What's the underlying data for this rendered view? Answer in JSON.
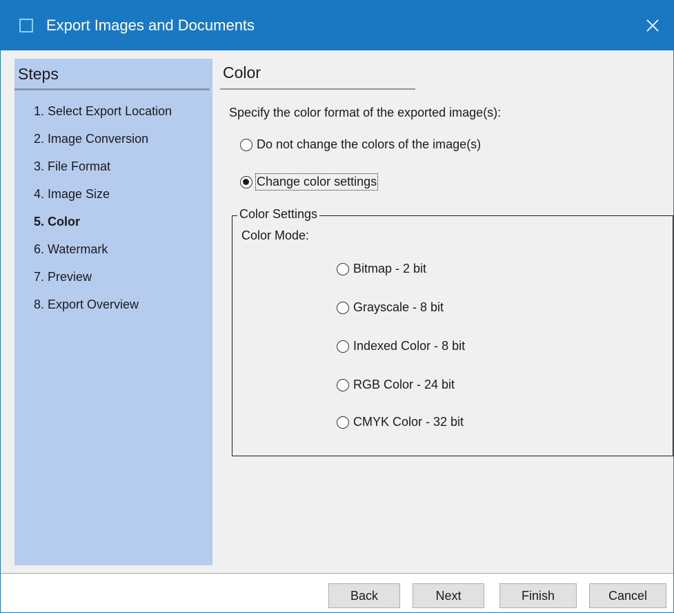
{
  "window": {
    "title": "Export Images and Documents",
    "icon": "app-window-icon",
    "close_icon": "close-icon",
    "accent_color": "#1a78c2",
    "sidebar_color": "#b6ccef"
  },
  "sidebar": {
    "title": "Steps",
    "items": [
      {
        "label": "1. Select Export Location",
        "active": false
      },
      {
        "label": "2. Image Conversion",
        "active": false
      },
      {
        "label": "3. File Format",
        "active": false
      },
      {
        "label": "4. Image Size",
        "active": false
      },
      {
        "label": "5. Color",
        "active": true
      },
      {
        "label": "6. Watermark",
        "active": false
      },
      {
        "label": "7. Preview",
        "active": false
      },
      {
        "label": "8. Export Overview",
        "active": false
      }
    ]
  },
  "main": {
    "title": "Color",
    "instruction": "Specify the color format of the exported image(s):",
    "options": [
      {
        "label": "Do not change the colors of the image(s)",
        "checked": false
      },
      {
        "label": "Change color settings",
        "checked": true
      }
    ],
    "color_settings": {
      "legend": "Color Settings",
      "mode_label": "Color Mode:",
      "modes": [
        {
          "label": "Bitmap - 2 bit",
          "checked": false
        },
        {
          "label": "Grayscale - 8 bit",
          "checked": false
        },
        {
          "label": "Indexed Color - 8 bit",
          "checked": false
        },
        {
          "label": "RGB Color - 24 bit",
          "checked": false
        },
        {
          "label": "CMYK Color - 32 bit",
          "checked": false
        }
      ]
    }
  },
  "footer": {
    "back_label": "Back",
    "next_label": "Next",
    "finish_label": "Finish",
    "cancel_label": "Cancel"
  }
}
